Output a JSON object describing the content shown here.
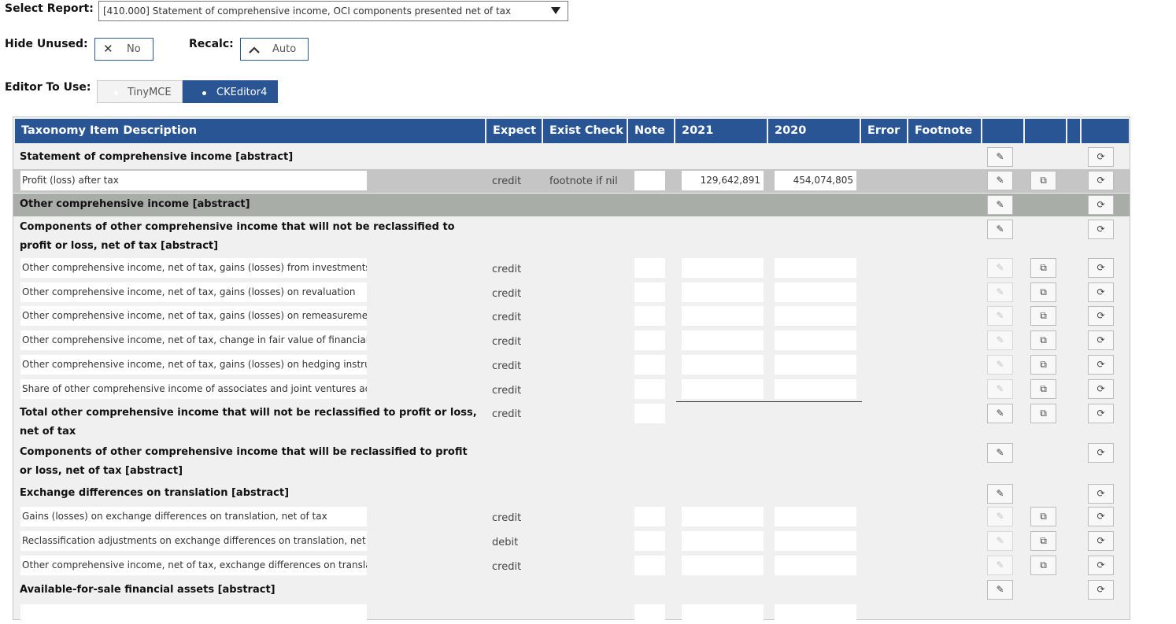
{
  "controls": {
    "select_report_label": "Select Report:",
    "select_report_value": "[410.000] Statement of comprehensive income, OCI components presented net of tax",
    "hide_unused_label": "Hide Unused:",
    "hide_unused_value": "No",
    "recalc_label": "Recalc:",
    "recalc_value": "Auto",
    "editor_label": "Editor To Use:",
    "editor_options": [
      "TinyMCE",
      "CKEditor4"
    ],
    "editor_selected": "CKEditor4"
  },
  "table": {
    "headers": [
      "Taxonomy Item Description",
      "Expect",
      "Exist Check",
      "Note",
      "2021",
      "2020",
      "Error",
      "Footnote",
      "",
      "",
      "",
      ""
    ],
    "rows": [
      {
        "type": "abstract",
        "label": "Statement of comprehensive income [abstract]",
        "edit": true
      },
      {
        "type": "item",
        "label": "Profit (loss) after tax",
        "expect": "credit",
        "exist_check": "footnote if nil",
        "v2021": "129,642,891",
        "v2020": "454,074,805",
        "edit": true,
        "copy": true
      },
      {
        "type": "abstract",
        "label": "Other comprehensive income [abstract]",
        "edit": true
      },
      {
        "type": "abstract",
        "label": "Components of other comprehensive income that will not be reclassified to profit or loss, net of tax [abstract]",
        "edit": true
      },
      {
        "type": "item",
        "label": "Other comprehensive income, net of tax, gains (losses) from investments in e",
        "expect": "credit",
        "v2021": "",
        "v2020": "",
        "edit": false,
        "copy": true
      },
      {
        "type": "item",
        "label": "Other comprehensive income, net of tax, gains (losses) on revaluation",
        "expect": "credit",
        "v2021": "",
        "v2020": "",
        "edit": false,
        "copy": true
      },
      {
        "type": "item",
        "label": "Other comprehensive income, net of tax, gains (losses) on remeasurements c",
        "expect": "credit",
        "v2021": "",
        "v2020": "",
        "edit": false,
        "copy": true
      },
      {
        "type": "item",
        "label": "Other comprehensive income, net of tax, change in fair value of financial liab",
        "expect": "credit",
        "v2021": "",
        "v2020": "",
        "edit": false,
        "copy": true
      },
      {
        "type": "item",
        "label": "Other comprehensive income, net of tax, gains (losses) on hedging instrume",
        "expect": "credit",
        "v2021": "",
        "v2020": "",
        "edit": false,
        "copy": true
      },
      {
        "type": "item",
        "label": "Share of other comprehensive income of associates and joint ventures accou",
        "expect": "credit",
        "v2021": "",
        "v2020": "",
        "edit": false,
        "copy": true
      },
      {
        "type": "total",
        "label": "Total other comprehensive income that will not be reclassified to profit or loss, net of tax",
        "expect": "credit",
        "edit": true,
        "copy": true
      },
      {
        "type": "abstract",
        "label": "Components of other comprehensive income that will be reclassified to profit or loss, net of tax [abstract]",
        "edit": true
      },
      {
        "type": "abstract",
        "label": "Exchange differences on translation [abstract]",
        "edit": true
      },
      {
        "type": "item",
        "label": "Gains (losses) on exchange differences on translation, net of tax",
        "expect": "credit",
        "v2021": "",
        "v2020": "",
        "edit": false,
        "copy": true
      },
      {
        "type": "item",
        "label": "Reclassification adjustments on exchange differences on translation, net of ta",
        "expect": "debit",
        "v2021": "",
        "v2020": "",
        "edit": false,
        "copy": true
      },
      {
        "type": "item",
        "label": "Other comprehensive income, net of tax, exchange differences on translatior",
        "expect": "credit",
        "v2021": "",
        "v2020": "",
        "edit": false,
        "copy": true
      },
      {
        "type": "abstract",
        "label": "Available-for-sale financial assets [abstract]",
        "edit": true
      }
    ]
  },
  "colors": {
    "header_bg": "#2a5595",
    "selected_row": "#c5c5c5",
    "section_row": "#a9ada7",
    "panel_bg": "#f0f0f0"
  },
  "icons": {
    "edit": "pencil-icon",
    "copy": "copy-icon",
    "reset": "refresh-icon",
    "hide_unused": "close-icon",
    "recalc": "chevron-up-icon"
  }
}
